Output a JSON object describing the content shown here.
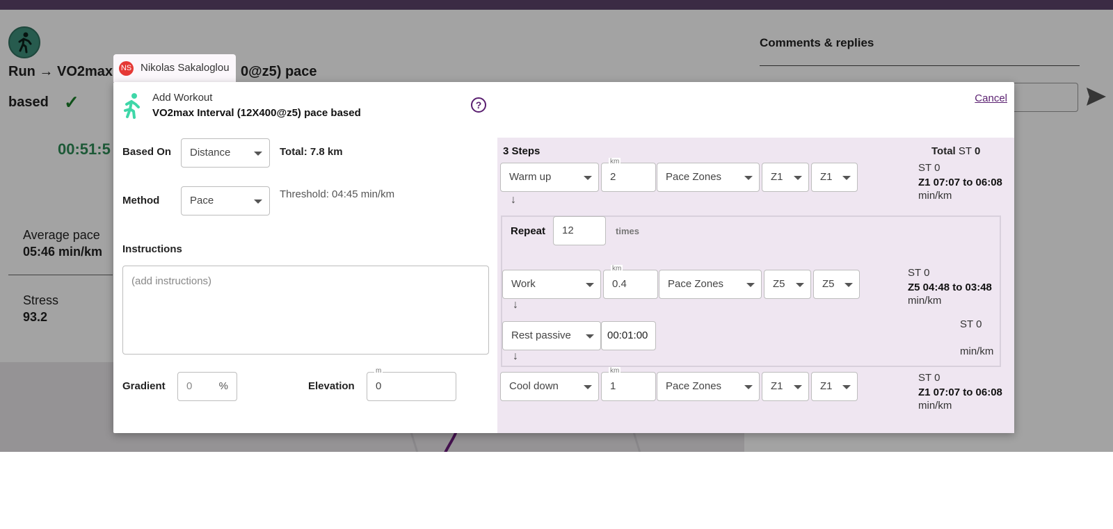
{
  "background": {
    "title_line1": "Run → VO2max Int",
    "title_tail": "0@z5) pace",
    "title_line2": "based",
    "check": "✓",
    "duration": "00:51:5",
    "avg_pace_label": "Average pace",
    "avg_pace_value": "05:46 min/km",
    "stress_label": "Stress",
    "stress_value": "93.2",
    "comments_title": "Comments & replies"
  },
  "user_tag": {
    "initials": "NS",
    "name": "Nikolas Sakaloglou"
  },
  "modal": {
    "header_title": "Add Workout",
    "workout_name": "VO2max Interval (12X400@z5) pace based",
    "help": "?",
    "cancel_label": "Cancel",
    "based_on_label": "Based On",
    "based_on_value": "Distance",
    "total": "Total: 7.8 km",
    "method_label": "Method",
    "method_value": "Pace",
    "threshold": "Threshold: 04:45 min/km",
    "instructions_label": "Instructions",
    "instructions_placeholder": "(add instructions)",
    "gradient_label": "Gradient",
    "gradient_value": "0",
    "gradient_unit": "%",
    "elevation_label": "Elevation",
    "elevation_value": "0",
    "elevation_unit": "m"
  },
  "steps": {
    "count_label": "3 Steps",
    "total_label": "Total",
    "total_st_label": "ST",
    "total_st_value": "0",
    "km_label": "km",
    "warmup": {
      "type": "Warm up",
      "distance": "2",
      "zone_type": "Pace Zones",
      "zone_from": "Z1",
      "zone_to": "Z1",
      "st": "ST 0",
      "range": "Z1 07:07 to 06:08",
      "unit": "min/km"
    },
    "repeat": {
      "label": "Repeat",
      "count": "12",
      "times": "times"
    },
    "work": {
      "type": "Work",
      "distance": "0.4",
      "zone_type": "Pace Zones",
      "zone_from": "Z5",
      "zone_to": "Z5",
      "st": "ST 0",
      "range": "Z5 04:48 to 03:48",
      "unit": "min/km"
    },
    "rest": {
      "type": "Rest passive",
      "duration": "00:01:00",
      "st": "ST 0",
      "unit": "min/km"
    },
    "cooldown": {
      "type": "Cool down",
      "distance": "1",
      "zone_type": "Pace Zones",
      "zone_from": "Z1",
      "zone_to": "Z1",
      "st": "ST 0",
      "range": "Z1 07:07 to 06:08",
      "unit": "min/km"
    },
    "arrow": "↓"
  }
}
